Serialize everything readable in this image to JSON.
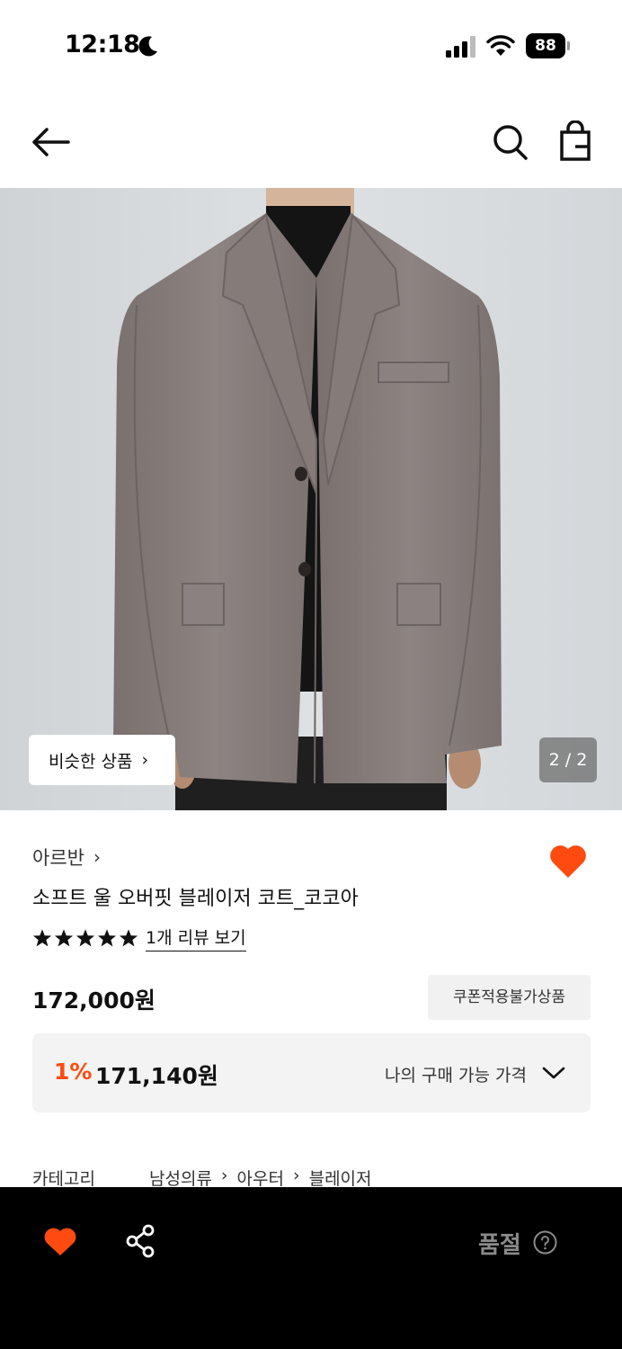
{
  "status_bar": {
    "time": "12:18",
    "battery": "88"
  },
  "nav": {
    "back_icon": "arrow-left-icon",
    "search_icon": "search-icon",
    "bag_icon": "shopping-bag-icon"
  },
  "image": {
    "similar_label": "비슷한 상품",
    "counter": "2 / 2"
  },
  "product": {
    "brand": "아르반",
    "name": "소프트 울 오버핏 블레이저 코트_코코아",
    "rating_stars": 5,
    "review_link": "1개 리뷰 보기",
    "price": "172,000원",
    "coupon_badge": "쿠폰적용불가상품",
    "discount_rate": "1%",
    "member_price": "171,140원",
    "member_price_label": "나의 구매 가능 가격"
  },
  "category": {
    "label": "카테고리",
    "path": [
      "남성의류",
      "아우터",
      "블레이저"
    ]
  },
  "bottom_bar": {
    "soldout": "품절"
  },
  "colors": {
    "accent": "#ff4a10",
    "heart": "#ff4a10",
    "bottom_bg": "#000000"
  }
}
